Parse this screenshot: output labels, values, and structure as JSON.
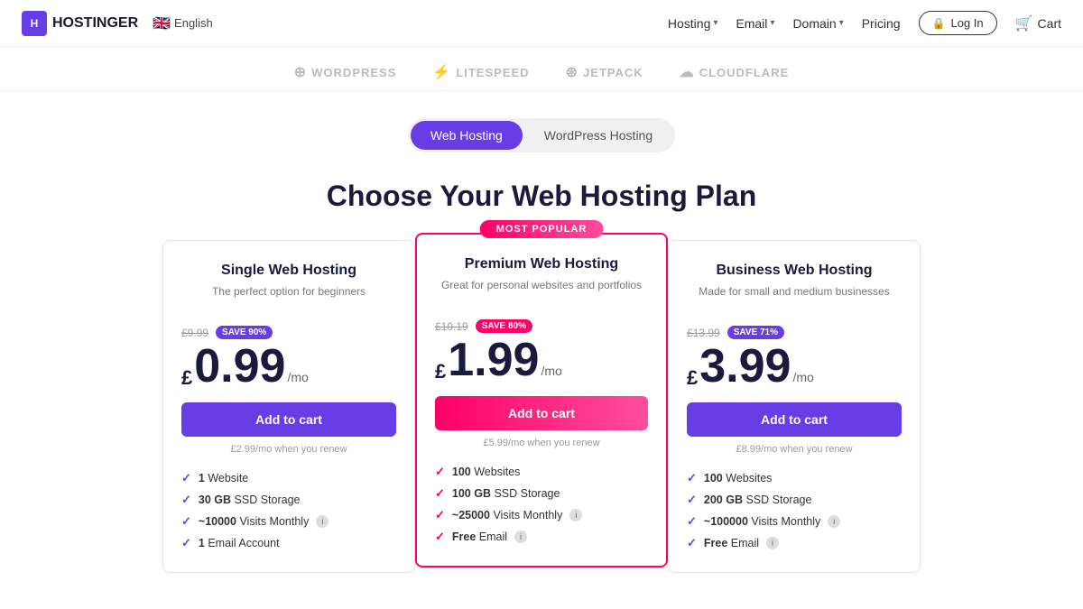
{
  "navbar": {
    "logo_text": "HOSTINGER",
    "language": "English",
    "flag": "🇬🇧",
    "nav_items": [
      {
        "label": "Hosting",
        "has_dropdown": true
      },
      {
        "label": "Email",
        "has_dropdown": true
      },
      {
        "label": "Domain",
        "has_dropdown": true
      }
    ],
    "pricing_label": "Pricing",
    "login_label": "Log In",
    "cart_label": "Cart"
  },
  "partners": [
    {
      "name": "WordPress",
      "icon": "⊕"
    },
    {
      "name": "LiteSpeed",
      "icon": "⚡"
    },
    {
      "name": "Jetpack",
      "icon": "⊛"
    },
    {
      "name": "Cloudflare",
      "icon": "☁"
    }
  ],
  "tabs": {
    "items": [
      {
        "label": "Web Hosting",
        "active": true
      },
      {
        "label": "WordPress Hosting",
        "active": false
      }
    ]
  },
  "main": {
    "heading": "Choose Your Web Hosting Plan"
  },
  "plans": [
    {
      "id": "single",
      "title": "Single Web Hosting",
      "subtitle": "The perfect option for beginners",
      "original_price": "£9.99",
      "save_label": "SAVE 90%",
      "save_color": "purple",
      "price_currency": "£",
      "price_number": "0.99",
      "price_period": "/mo",
      "btn_label": "Add to cart",
      "btn_style": "purple",
      "renew_text": "£2.99/mo when you renew",
      "popular": false,
      "features": [
        {
          "bold": "1",
          "text": " Website",
          "has_info": false
        },
        {
          "bold": "30 GB",
          "text": " SSD Storage",
          "has_info": false
        },
        {
          "bold": "~10000",
          "text": " Visits Monthly",
          "has_info": true
        },
        {
          "bold": "1",
          "text": " Email Account",
          "has_info": false
        }
      ]
    },
    {
      "id": "premium",
      "title": "Premium Web Hosting",
      "subtitle": "Great for personal websites and portfolios",
      "original_price": "£10.19",
      "save_label": "SAVE 80%",
      "save_color": "pink",
      "price_currency": "£",
      "price_number": "1.99",
      "price_period": "/mo",
      "btn_label": "Add to cart",
      "btn_style": "pink",
      "renew_text": "£5.99/mo when you renew",
      "popular": true,
      "popular_label": "MOST POPULAR",
      "features": [
        {
          "bold": "100",
          "text": " Websites",
          "has_info": false
        },
        {
          "bold": "100 GB",
          "text": " SSD Storage",
          "has_info": false
        },
        {
          "bold": "~25000",
          "text": " Visits Monthly",
          "has_info": true
        },
        {
          "bold": "Free",
          "text": " Email",
          "has_info": true
        }
      ]
    },
    {
      "id": "business",
      "title": "Business Web Hosting",
      "subtitle": "Made for small and medium businesses",
      "original_price": "£13.99",
      "save_label": "SAVE 71%",
      "save_color": "purple",
      "price_currency": "£",
      "price_number": "3.99",
      "price_period": "/mo",
      "btn_label": "Add to cart",
      "btn_style": "purple",
      "renew_text": "£8.99/mo when you renew",
      "popular": false,
      "features": [
        {
          "bold": "100",
          "text": " Websites",
          "has_info": false
        },
        {
          "bold": "200 GB",
          "text": " SSD Storage",
          "has_info": false
        },
        {
          "bold": "~100000",
          "text": " Visits Monthly",
          "has_info": true
        },
        {
          "bold": "Free",
          "text": " Email",
          "has_info": true
        }
      ]
    }
  ]
}
